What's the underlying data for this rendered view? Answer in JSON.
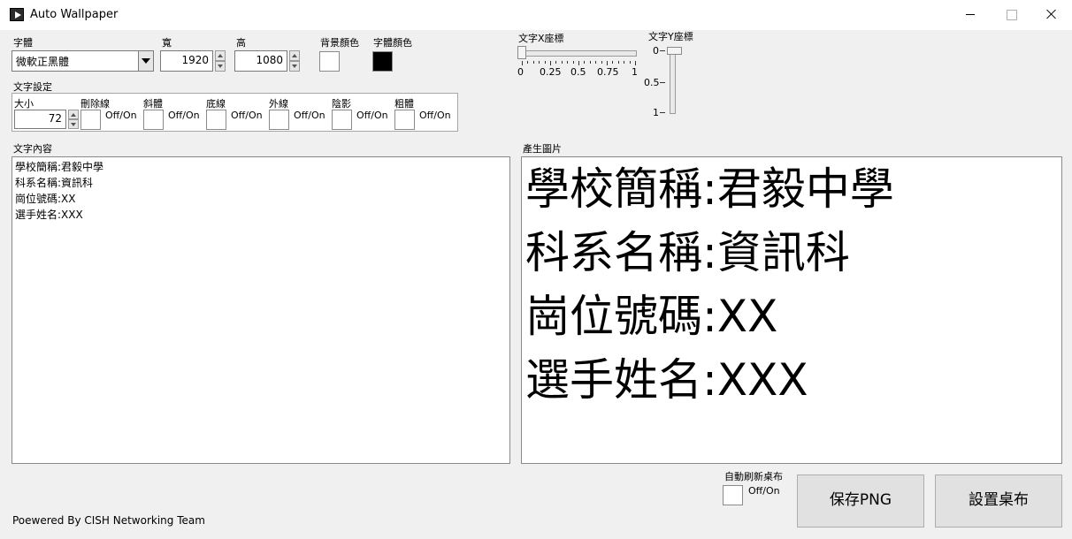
{
  "window": {
    "title": "Auto Wallpaper"
  },
  "font": {
    "label": "字體",
    "value": "微軟正黑體"
  },
  "width": {
    "label": "寬",
    "value": "1920"
  },
  "height": {
    "label": "高",
    "value": "1080"
  },
  "bg_color": {
    "label": "背景顏色",
    "color": "#ffffff"
  },
  "text_color": {
    "label": "字體顏色",
    "color": "#000000"
  },
  "text_settings": {
    "label": "文字設定",
    "size_label": "大小",
    "size_value": "72",
    "toggles": [
      {
        "label": "刪除線",
        "state": "Off/On"
      },
      {
        "label": "斜體",
        "state": "Off/On"
      },
      {
        "label": "底線",
        "state": "Off/On"
      },
      {
        "label": "外線",
        "state": "Off/On"
      },
      {
        "label": "陰影",
        "state": "Off/On"
      },
      {
        "label": "粗體",
        "state": "Off/On"
      }
    ]
  },
  "x_slider": {
    "label": "文字X座標",
    "ticks": [
      "0",
      "0.25",
      "0.5",
      "0.75",
      "1"
    ],
    "value": 0
  },
  "y_slider": {
    "label": "文字Y座標",
    "ticks": [
      "0",
      "0.5",
      "1"
    ],
    "value": 0
  },
  "content": {
    "label": "文字內容",
    "text": "學校簡稱:君毅中學\n科系名稱:資訊科\n崗位號碼:XX\n選手姓名:XXX"
  },
  "preview": {
    "label": "產生圖片",
    "text": "學校簡稱:君毅中學\n科系名稱:資訊科\n崗位號碼:XX\n選手姓名:XXX"
  },
  "auto_refresh": {
    "label": "自動刷新桌布",
    "state": "Off/On"
  },
  "buttons": {
    "save_png": "保存PNG",
    "set_wallpaper": "設置桌布"
  },
  "footer": "Poewered By CISH Networking Team"
}
